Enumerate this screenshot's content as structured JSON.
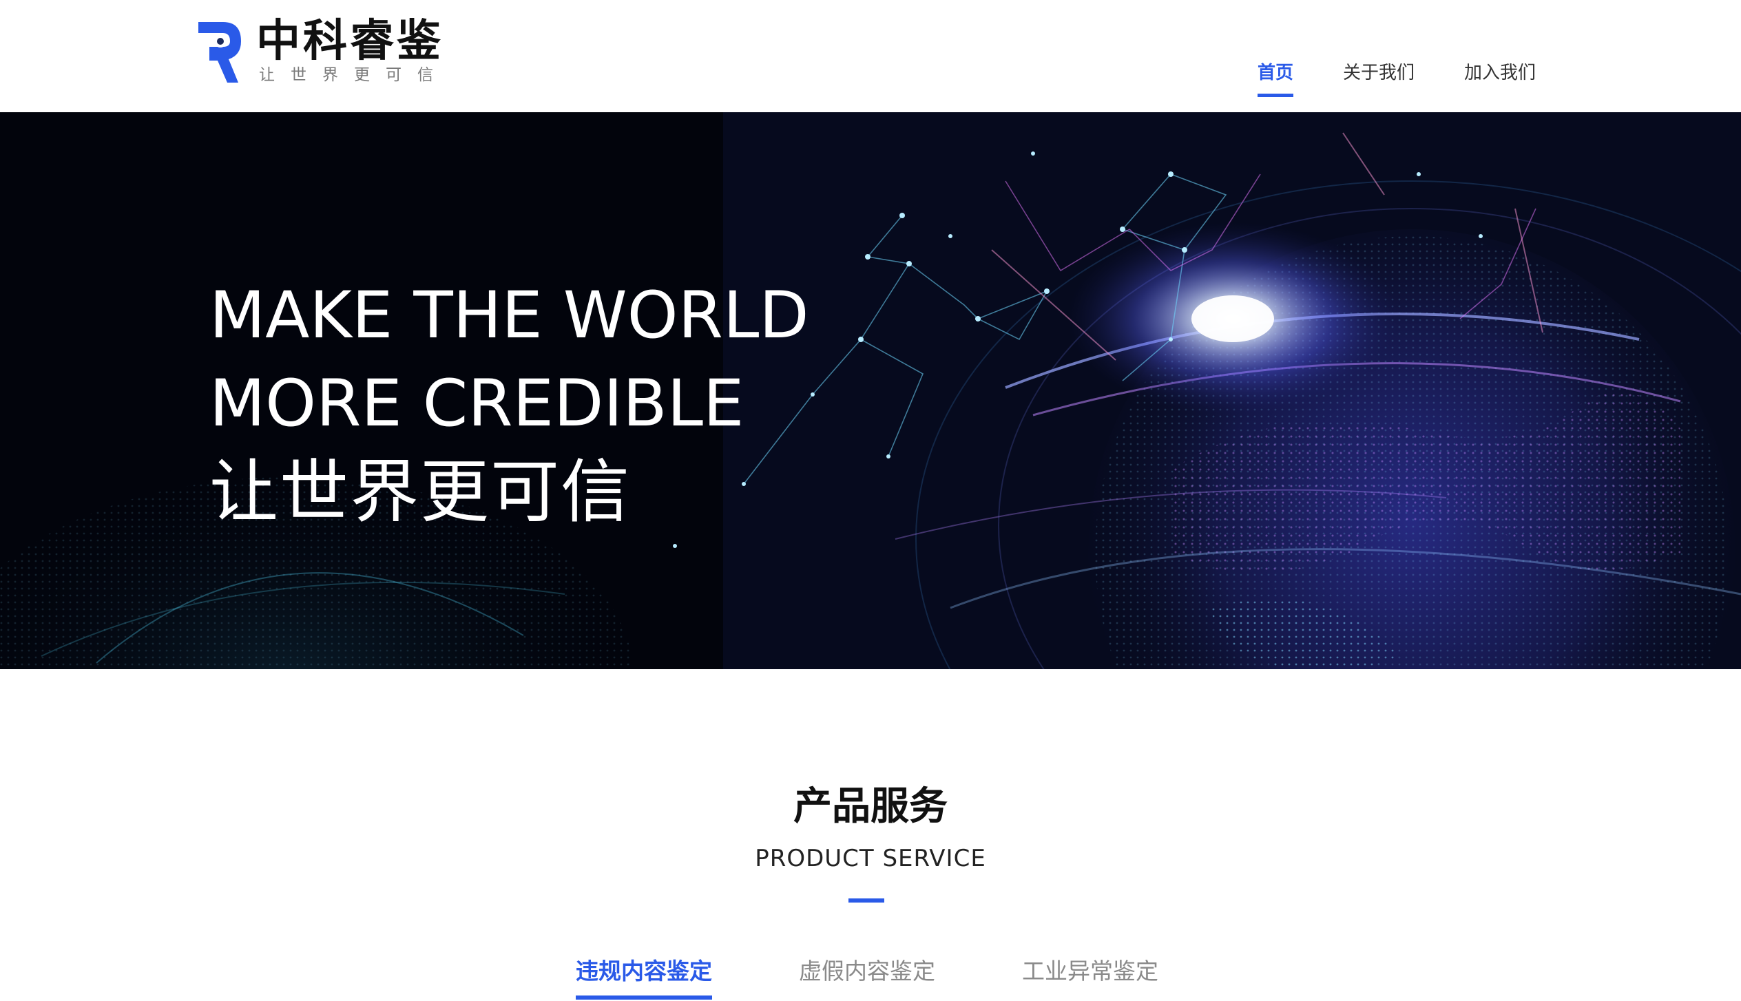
{
  "brand": {
    "name": "中科睿鉴",
    "slogan": "让世界更可信",
    "accent_color": "#2a5ae8"
  },
  "nav": {
    "items": [
      {
        "label": "首页",
        "active": true
      },
      {
        "label": "关于我们",
        "active": false
      },
      {
        "label": "加入我们",
        "active": false
      }
    ]
  },
  "hero": {
    "line1": "MAKE THE WORLD",
    "line2": "MORE CREDIBLE",
    "line3": "让世界更可信"
  },
  "products": {
    "title": "产品服务",
    "subtitle": "PRODUCT SERVICE",
    "tabs": [
      {
        "label": "违规内容鉴定",
        "active": true
      },
      {
        "label": "虚假内容鉴定",
        "active": false
      },
      {
        "label": "工业异常鉴定",
        "active": false
      }
    ]
  }
}
